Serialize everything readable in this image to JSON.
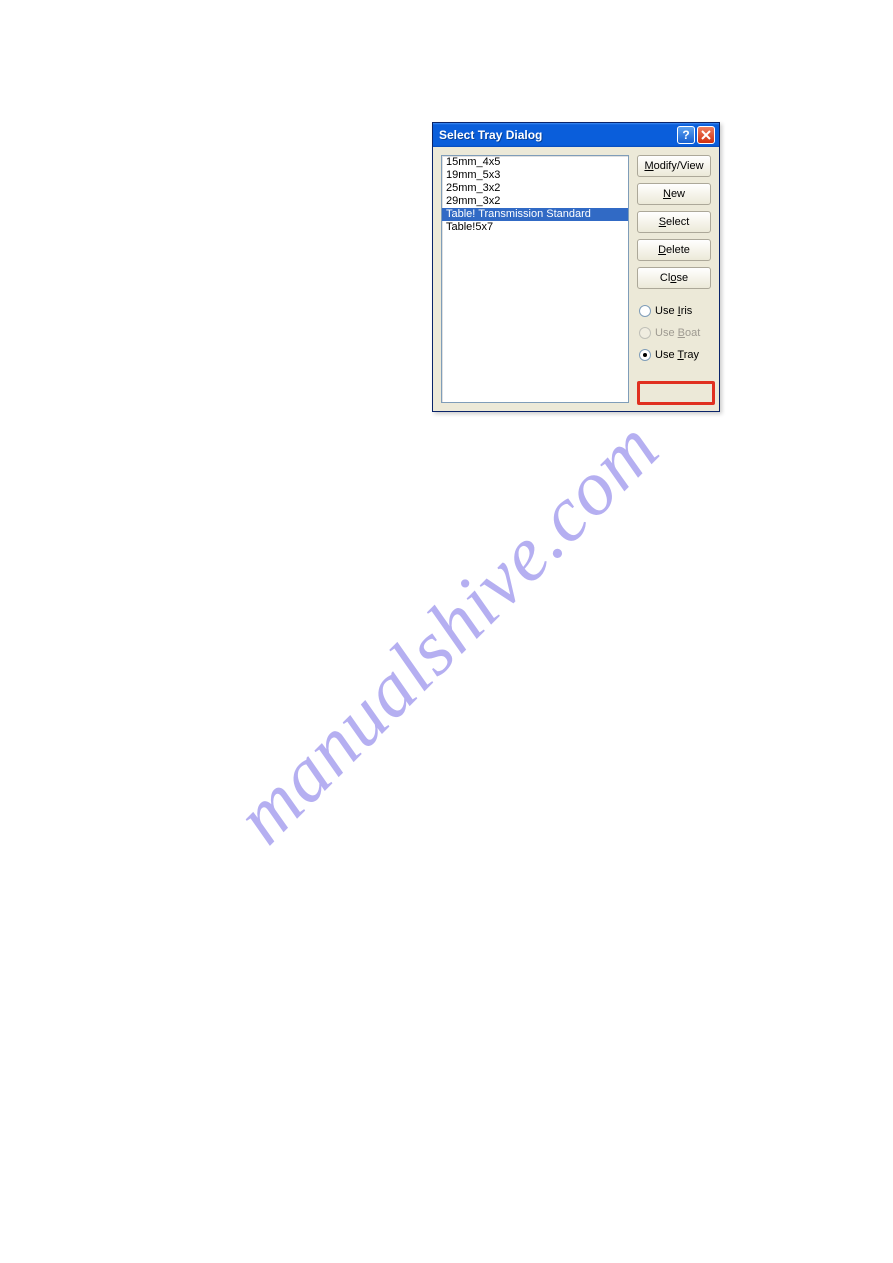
{
  "watermark": "manualshive.com",
  "dialog": {
    "title": "Select Tray Dialog",
    "help_tooltip": "?",
    "close_tooltip": "Close",
    "list_items": {
      "i0": "15mm_4x5",
      "i1": "19mm_5x3",
      "i2": "25mm_3x2",
      "i3": "29mm_3x2",
      "i4": "Table! Transmission Standard",
      "i5": "Table!5x7"
    },
    "selected_index": 4,
    "buttons": {
      "modify_view_pre": "",
      "modify_view_u": "M",
      "modify_view_post": "odify/View",
      "new_u": "N",
      "new_post": "ew",
      "select_pre": "",
      "select_u": "S",
      "select_post": "elect",
      "delete_u": "D",
      "delete_post": "elete",
      "close_pre": "Cl",
      "close_u": "o",
      "close_post": "se"
    },
    "radios": {
      "iris_pre": "Use ",
      "iris_u": "I",
      "iris_post": "ris",
      "boat_pre": "Use ",
      "boat_u": "B",
      "boat_post": "oat",
      "tray_pre": "Use ",
      "tray_u": "T",
      "tray_post": "ray"
    },
    "radio_state": {
      "iris_selected": false,
      "boat_selected": false,
      "boat_enabled": false,
      "tray_selected": true
    }
  }
}
